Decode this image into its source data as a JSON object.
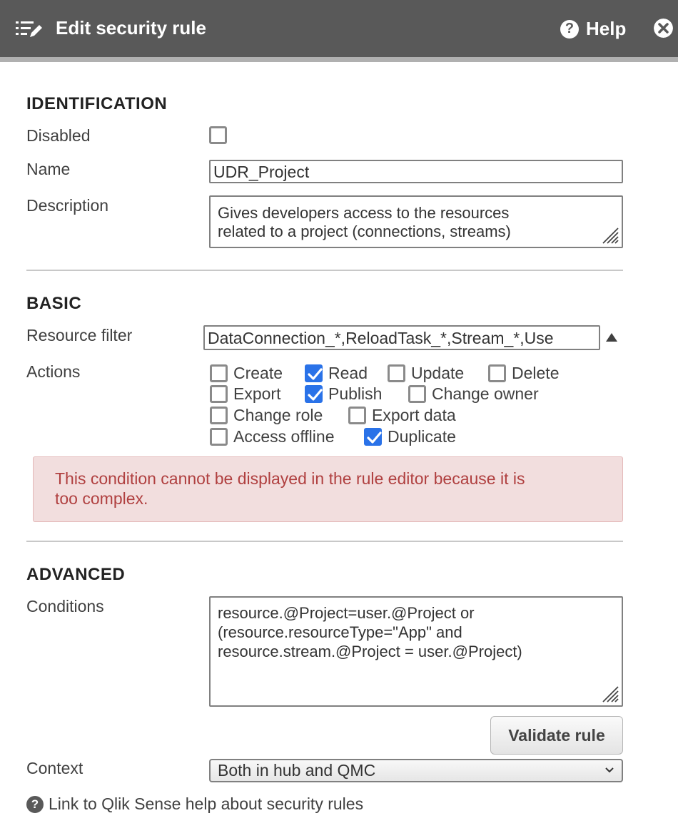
{
  "header": {
    "title": "Edit security rule",
    "help_label": "Help"
  },
  "identification": {
    "section_title": "IDENTIFICATION",
    "disabled_label": "Disabled",
    "disabled_checked": false,
    "name_label": "Name",
    "name_value": "UDR_Project",
    "description_label": "Description",
    "description_line1": "Gives developers access to the resources",
    "description_line2": "related to a project (connections, streams)"
  },
  "basic": {
    "section_title": "BASIC",
    "resource_filter_label": "Resource filter",
    "resource_filter_value": "DataConnection_*,ReloadTask_*,Stream_*,Use",
    "actions_label": "Actions",
    "actions": [
      {
        "label": "Create",
        "checked": false
      },
      {
        "label": "Read",
        "checked": true
      },
      {
        "label": "Update",
        "checked": false
      },
      {
        "label": "Delete",
        "checked": false
      },
      {
        "label": "Export",
        "checked": false
      },
      {
        "label": "Publish",
        "checked": true
      },
      {
        "label": "Change owner",
        "checked": false
      },
      {
        "label": "Change role",
        "checked": false
      },
      {
        "label": "Export data",
        "checked": false
      },
      {
        "label": "Access offline",
        "checked": false
      },
      {
        "label": "Duplicate",
        "checked": true
      }
    ],
    "warning_line1": "This condition cannot be displayed in the rule editor because it is",
    "warning_line2": "too complex."
  },
  "advanced": {
    "section_title": "ADVANCED",
    "conditions_label": "Conditions",
    "conditions_line1": "resource.@Project=user.@Project or",
    "conditions_line2": "(resource.resourceType=\"App\" and",
    "conditions_line3": "resource.stream.@Project = user.@Project)",
    "validate_label": "Validate rule",
    "context_label": "Context",
    "context_value": "Both in hub and QMC"
  },
  "help_link": "Link to Qlik Sense help about security rules",
  "colors": {
    "header_bg": "#595959",
    "checkbox_checked": "#2a72e8",
    "warning_bg": "#f2dede",
    "warning_text": "#b04040"
  }
}
